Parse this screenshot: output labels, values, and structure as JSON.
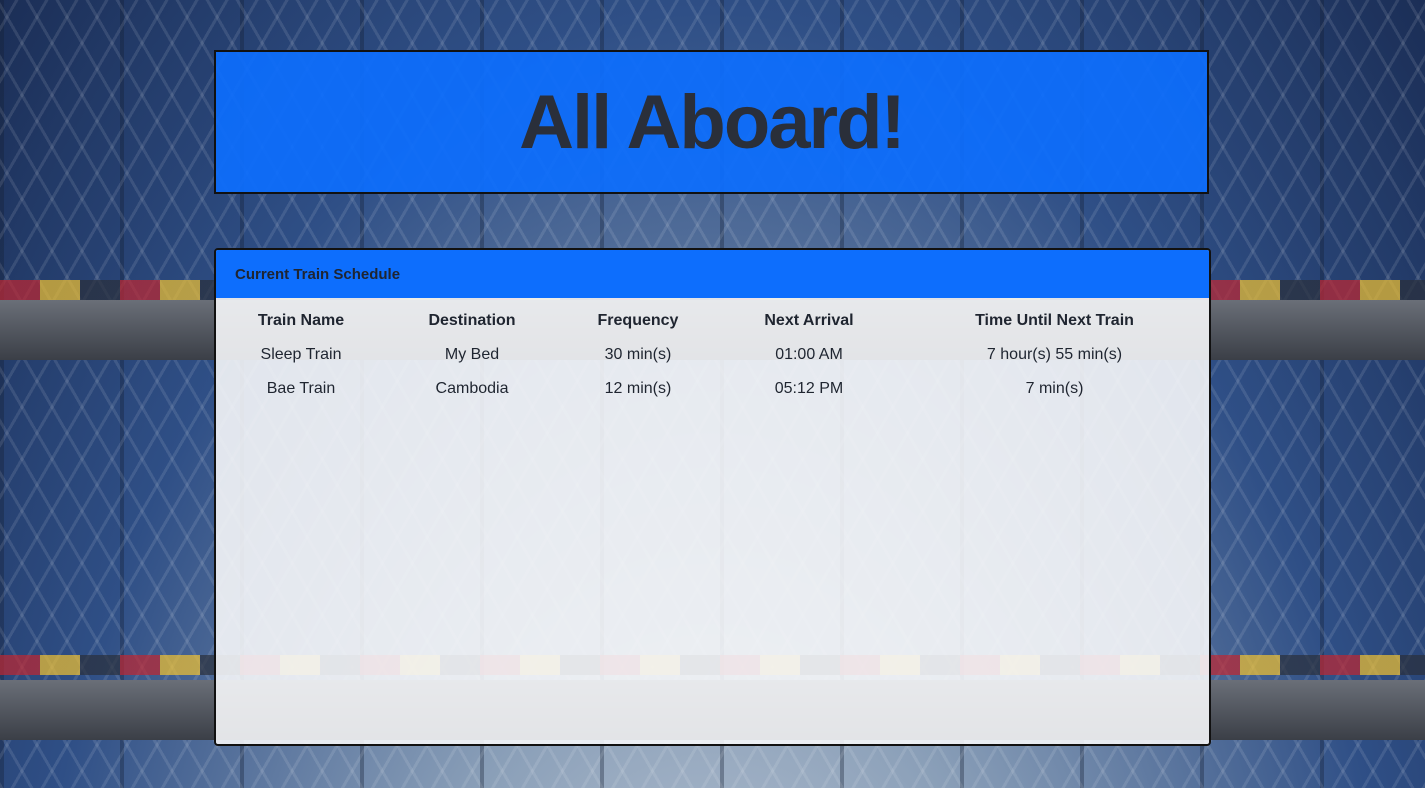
{
  "header": {
    "title": "All Aboard!"
  },
  "schedule": {
    "heading": "Current Train Schedule",
    "columns": [
      "Train Name",
      "Destination",
      "Frequency",
      "Next Arrival",
      "Time Until Next Train"
    ],
    "rows": [
      [
        "Sleep Train",
        "My Bed",
        "30 min(s)",
        "01:00 AM",
        "7 hour(s) 55 min(s)"
      ],
      [
        "Bae Train",
        "Cambodia",
        "12 min(s)",
        "05:12 PM",
        "7 min(s)"
      ]
    ]
  },
  "colors": {
    "accent": "#0d6efd",
    "text": "#1f2530"
  }
}
